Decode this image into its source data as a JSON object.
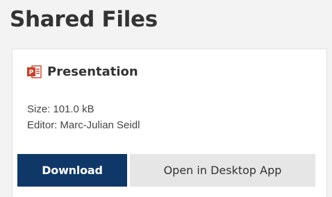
{
  "page": {
    "title": "Shared Files"
  },
  "file": {
    "icon": "powerpoint-file-icon",
    "name": "Presentation",
    "size_label": "Size:",
    "size_value": "101.0 kB",
    "editor_label": "Editor:",
    "editor_value": "Marc-Julian Seidl"
  },
  "actions": {
    "download_label": "Download",
    "open_desktop_label": "Open in Desktop App"
  },
  "colors": {
    "primary_button": "#0f3868",
    "secondary_button": "#e6e6e6",
    "powerpoint_icon": "#c4432b"
  }
}
